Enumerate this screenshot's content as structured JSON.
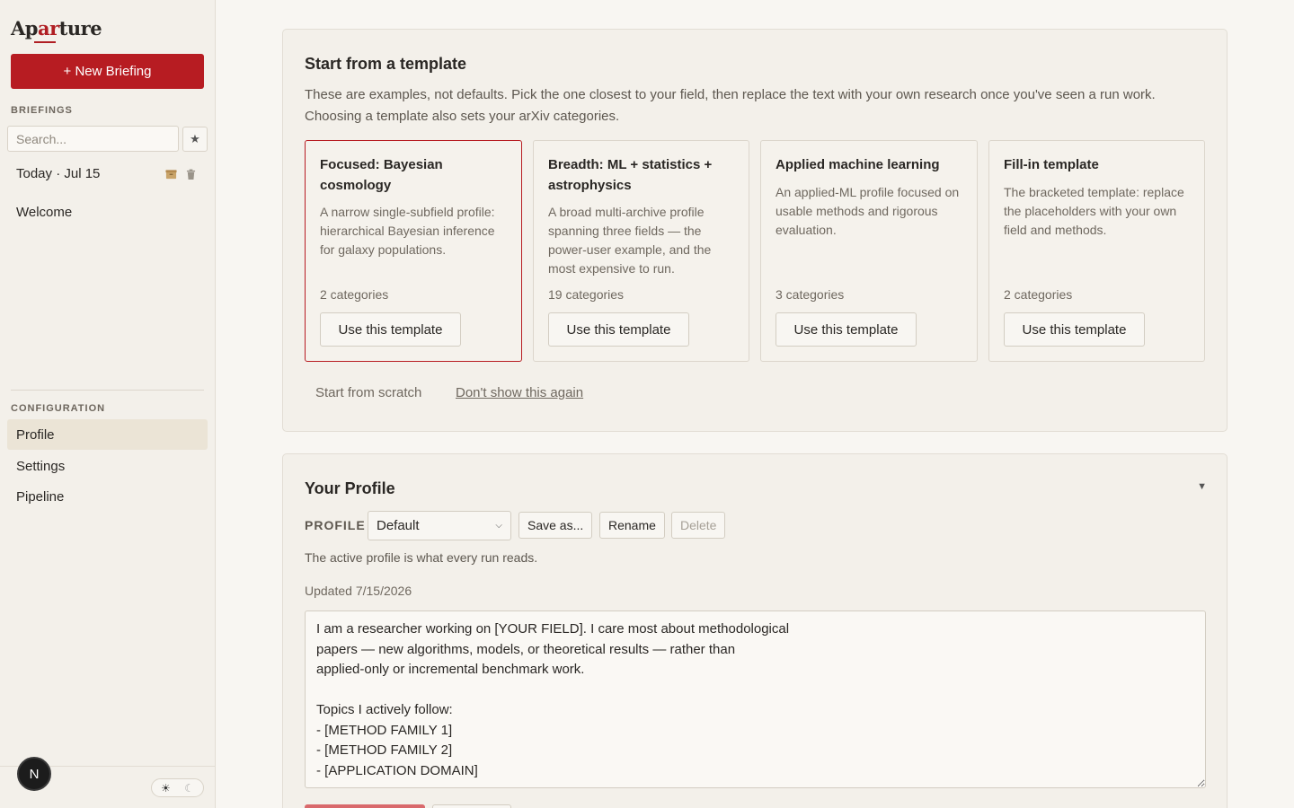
{
  "app": {
    "logo_prefix": "Ap",
    "logo_mid": "ar",
    "logo_suffix": "ture",
    "accent_color": "#b71c22"
  },
  "sidebar": {
    "new_briefing_label": "+ New Briefing",
    "briefings_section": "BRIEFINGS",
    "search_placeholder": "Search...",
    "star_icon": "★",
    "briefings": [
      {
        "label": "Today · Jul 15",
        "icons": [
          "archive-icon",
          "trash-icon"
        ]
      }
    ],
    "welcome_label": "Welcome",
    "configuration_section": "CONFIGURATION",
    "nav": [
      {
        "label": "Profile",
        "active": true
      },
      {
        "label": "Settings",
        "active": false
      },
      {
        "label": "Pipeline",
        "active": false
      }
    ],
    "avatar_initial": "N",
    "theme_sun": "☀",
    "theme_moon": "☾"
  },
  "templates_card": {
    "title": "Start from a template",
    "description": "These are examples, not defaults. Pick the one closest to your field, then replace the text with your own research once you've seen a run work. Choosing a template also sets your arXiv categories.",
    "templates": [
      {
        "name": "Focused: Bayesian cosmology",
        "description": "A narrow single-subfield profile: hierarchical Bayesian inference for galaxy populations.",
        "categories": "2 categories",
        "button": "Use this template",
        "selected": true
      },
      {
        "name": "Breadth: ML + statistics + astrophysics",
        "description": "A broad multi-archive profile spanning three fields — the power-user example, and the most expensive to run.",
        "categories": "19 categories",
        "button": "Use this template",
        "selected": false
      },
      {
        "name": "Applied machine learning",
        "description": "An applied-ML profile focused on usable methods and rigorous evaluation.",
        "categories": "3 categories",
        "button": "Use this template",
        "selected": false
      },
      {
        "name": "Fill-in template",
        "description": "The bracketed template: replace the placeholders with your own field and methods.",
        "categories": "2 categories",
        "button": "Use this template",
        "selected": false
      }
    ],
    "start_from_scratch": "Start from scratch",
    "dont_show_again": "Don't show this again"
  },
  "profile_card": {
    "title": "Your Profile",
    "collapse_icon": "▼",
    "profile_label": "PROFILE",
    "selected_profile": "Default",
    "chevron": "⌄",
    "save_as": "Save as...",
    "rename": "Rename",
    "delete": "Delete",
    "active_note": "The active profile is what every run reads.",
    "updated": "Updated 7/15/2026",
    "profile_text": "I am a researcher working on [YOUR FIELD]. I care most about methodological\npapers — new algorithms, models, or theoretical results — rather than\napplied-only or incremental benchmark work.\n\nTopics I actively follow:\n- [METHOD FAMILY 1]\n- [METHOD FAMILY 2]\n- [APPLICATION DOMAIN]"
  }
}
